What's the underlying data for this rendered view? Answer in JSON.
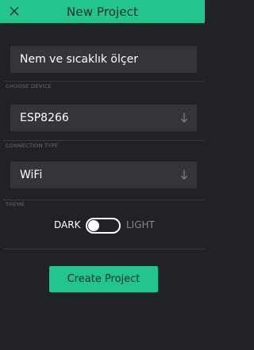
{
  "header": {
    "title": "New Project",
    "close_icon": "close-icon"
  },
  "project_name": {
    "value": "Nem ve sıcaklık ölçer"
  },
  "device": {
    "section_label": "CHOOSE DEVICE",
    "value": "ESP8266",
    "icon": "arrow-down-icon"
  },
  "connection": {
    "section_label": "CONNECTION TYPE",
    "value": "WiFi",
    "icon": "arrow-down-icon"
  },
  "theme": {
    "section_label": "THEME",
    "dark_label": "DARK",
    "light_label": "LIGHT",
    "selected": "DARK"
  },
  "actions": {
    "create_label": "Create Project"
  },
  "colors": {
    "accent": "#23c48e",
    "background": "#212227",
    "field": "#34353b"
  }
}
